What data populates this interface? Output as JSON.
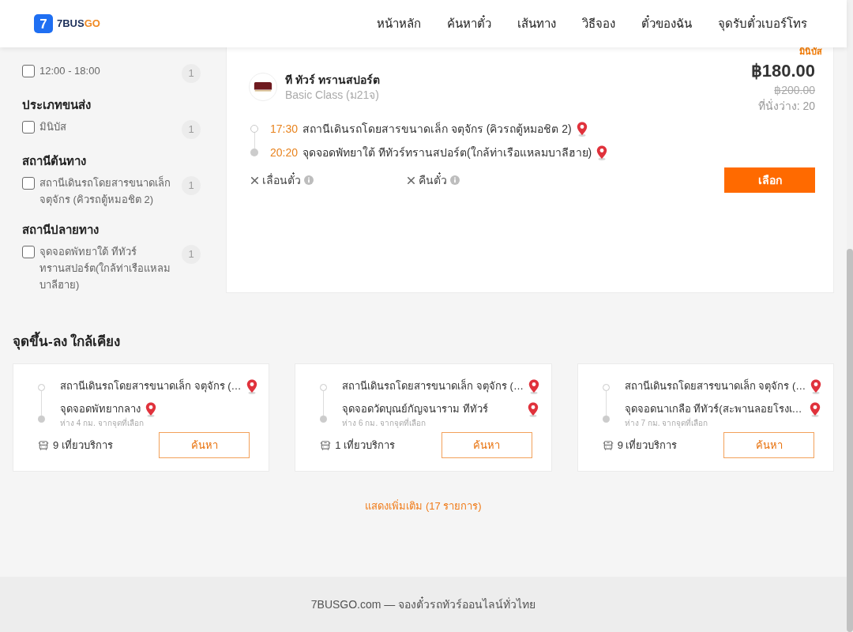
{
  "header": {
    "logo": {
      "mark": "7",
      "name": "7BUS",
      "accent": "GO"
    },
    "nav": [
      {
        "label": "หน้าหลัก"
      },
      {
        "label": "ค้นหาตั๋ว"
      },
      {
        "label": "เส้นทาง"
      },
      {
        "label": "วิธีจอง"
      },
      {
        "label": "ตั๋วของฉัน"
      },
      {
        "label": "จุดรับตั๋วเบอร์โทร"
      }
    ]
  },
  "filters": [
    {
      "options": [
        {
          "label": "12:00 - 18:00",
          "count": "1",
          "checked": false
        }
      ]
    },
    {
      "heading": "ประเภทขนส่ง",
      "options": [
        {
          "label": "มินิบัส",
          "count": "1",
          "checked": false
        }
      ]
    },
    {
      "heading": "สถานีต้นทาง",
      "options": [
        {
          "label": "สถานีเดินรถโดยสารขนาดเล็ก จตุจักร (คิวรถตู้หมอชิต 2)",
          "count": "1",
          "checked": false
        }
      ]
    },
    {
      "heading": "สถานีปลายทาง",
      "options": [
        {
          "label": "จุดจอดพัทยาใต้ ทีทัวร์ทรานสปอร์ต(ใกล้ท่าเรือแหลมบาลีฮาย)",
          "count": "1",
          "checked": false
        }
      ]
    }
  ],
  "result": {
    "tag": "มินิบัส",
    "operator": {
      "name": "ที ทัวร์ ทรานสปอร์ต",
      "class": "Basic Class (ม21จ)"
    },
    "price": "฿180.00",
    "old_price": "฿200.00",
    "seats": "ที่นั่งว่าง: 20",
    "stops": [
      {
        "kind": "origin",
        "time": "17:30",
        "place": "สถานีเดินรถโดยสารขนาดเล็ก จตุจักร (คิวรถตู้หมอชิต 2)"
      },
      {
        "kind": "destination",
        "time": "20:20",
        "place": "จุดจอดพัทยาใต้ ทีทัวร์ทรานสปอร์ต(ใกล้ท่าเรือแหลมบาลีฮาย)"
      }
    ],
    "policies": [
      {
        "label": "เลื่อนตั๋ว",
        "allowed": false
      },
      {
        "label": "คืนตั๋ว",
        "allowed": false
      }
    ],
    "button": "เลือก"
  },
  "nearby": {
    "title": "จุดขึ้น-ลง ใกล้เคียง",
    "cards": [
      {
        "from": "สถานีเดินรถโดยสารขนาดเล็ก จตุจักร (…",
        "to": "จุดจอดพัทยากลาง",
        "distance": "ห่าง 4 กม. จากจุดที่เลือก",
        "trips": "9 เที่ยวบริการ",
        "button": "ค้นหา"
      },
      {
        "from": "สถานีเดินรถโดยสารขนาดเล็ก จตุจักร (…",
        "to": "จุดจอดวัดบุณย์กัญจนาราม ทีทัวร์",
        "distance": "ห่าง 6 กม. จากจุดที่เลือก",
        "trips": "1 เที่ยวบริการ",
        "button": "ค้นหา"
      },
      {
        "from": "สถานีเดินรถโดยสารขนาดเล็ก จตุจักร (…",
        "to": "จุดจอดนาเกลือ ทีทัวร์(สะพานลอยโรงเ…",
        "distance": "ห่าง 7 กม. จากจุดที่เลือก",
        "trips": "9 เที่ยวบริการ",
        "button": "ค้นหา"
      }
    ],
    "more": "แสดงเพิ่มเติม (17 รายการ)"
  },
  "footer": {
    "text": "7BUSGO.com — จองตั๋วรถทัวร์ออนไลน์ทั่วไทย"
  }
}
